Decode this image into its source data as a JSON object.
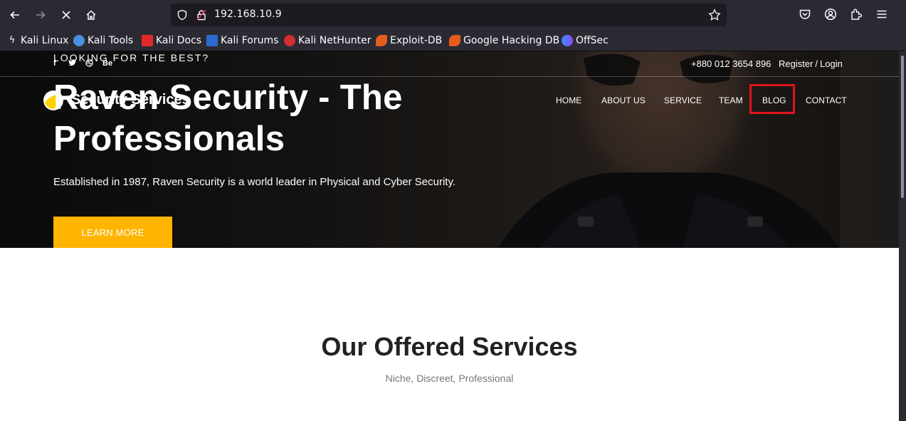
{
  "browser": {
    "url": "192.168.10.9",
    "bookmarks": [
      {
        "label": "Kali Linux",
        "icon": "kali-dragon-icon",
        "color": "#367bf0"
      },
      {
        "label": "Kali Tools",
        "icon": "kali-tools-icon",
        "color": "#4a90e2"
      },
      {
        "label": "Kali Docs",
        "icon": "kali-docs-icon",
        "color": "#e02a2a"
      },
      {
        "label": "Kali Forums",
        "icon": "kali-forums-icon",
        "color": "#2b6bd1"
      },
      {
        "label": "Kali NetHunter",
        "icon": "nethunter-icon",
        "color": "#d32f2f"
      },
      {
        "label": "Exploit-DB",
        "icon": "exploit-db-icon",
        "color": "#e65c1a"
      },
      {
        "label": "Google Hacking DB",
        "icon": "ghdb-icon",
        "color": "#e65c1a"
      },
      {
        "label": "OffSec",
        "icon": "offsec-icon",
        "color": "#6a5acd"
      }
    ]
  },
  "site": {
    "tagline": "LOOKING FOR THE BEST?",
    "social": [
      "f",
      "t",
      "dribbble",
      "Be"
    ],
    "phone": "+880 012 3654 896",
    "register": "Register",
    "separator": "/",
    "login": "Login",
    "logo_text": "Security Services",
    "nav": [
      "HOME",
      "ABOUT US",
      "SERVICE",
      "TEAM",
      "BLOG",
      "CONTACT"
    ],
    "highlighted_nav": "BLOG",
    "highlight_color": "#e0141e",
    "hero_title_line1": "Raven Security - The",
    "hero_title_line2": "Professionals",
    "hero_subtitle": "Established in 1987, Raven Security is a world leader in Physical and Cyber Security.",
    "cta": "LEARN MORE",
    "accent": "#ffb400",
    "section_title": "Our Offered Services",
    "section_subtitle": "Niche, Discreet, Professional"
  }
}
